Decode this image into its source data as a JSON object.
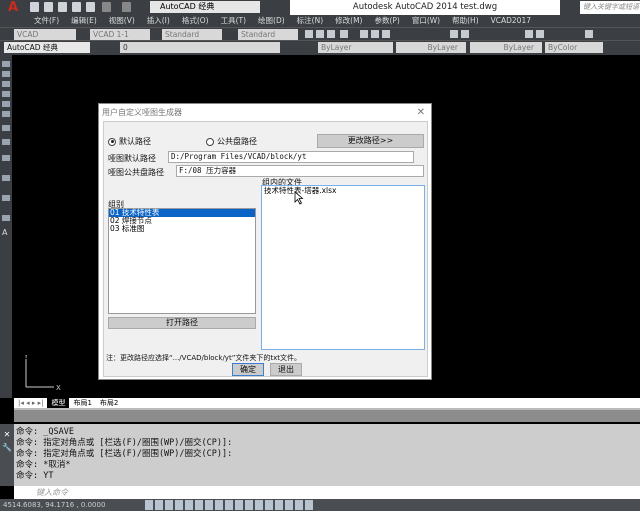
{
  "titlebar": {
    "workspace": "AutoCAD 经典",
    "title": "Autodesk AutoCAD 2014    test.dwg",
    "search_placeholder": "键入关键字或短语"
  },
  "menu": [
    "文件(F)",
    "编辑(E)",
    "视图(V)",
    "插入(I)",
    "格式(O)",
    "工具(T)",
    "绘图(D)",
    "标注(N)",
    "修改(M)",
    "参数(P)",
    "窗口(W)",
    "帮助(H)",
    "VCAD2017"
  ],
  "toolbar": {
    "text_style": "VCAD",
    "dim_style": "VCAD 1-1",
    "table_style": "Standard",
    "mleader_style": "Standard",
    "workspace2": "AutoCAD 经典",
    "layer": "0",
    "color": "ByLayer",
    "linetype": "ByLayer",
    "lineweight": "ByLayer",
    "plotstyle": "ByColor"
  },
  "dialog": {
    "title": "用户自定义哑图生成器",
    "radio_default": "默认路径",
    "radio_public": "公共盘路径",
    "change_path": "更改路径>>",
    "default_path_label": "哑图默认路径",
    "default_path": "D:/Program Files/VCAD/block/yt",
    "public_path_label": "哑图公共盘路径",
    "public_path": "F:/08 压力容器",
    "group_label": "组别",
    "groups": [
      "01 技术特性表",
      "02 焊接节点",
      "03 标准图"
    ],
    "files_label": "组内的文件",
    "files": [
      "技术特性表-塔器.xlsx"
    ],
    "open_path": "打开路径",
    "note": "注：更改路径应选择“.../VCAD/block/yt”文件夹下的txt文件。",
    "ok": "确定",
    "exit": "退出"
  },
  "tabs": [
    "模型",
    "布局1",
    "布局2"
  ],
  "command_lines": [
    "命令: _QSAVE",
    "命令: 指定对角点或 [栏选(F)/圈围(WP)/圈交(CP)]:",
    "命令: 指定对角点或 [栏选(F)/圈围(WP)/圈交(CP)]:",
    "命令: *取消*",
    "命令: YT"
  ],
  "command_placeholder": "键入命令",
  "status": {
    "coords": "4514.6083, 94.1716 , 0.0000"
  }
}
